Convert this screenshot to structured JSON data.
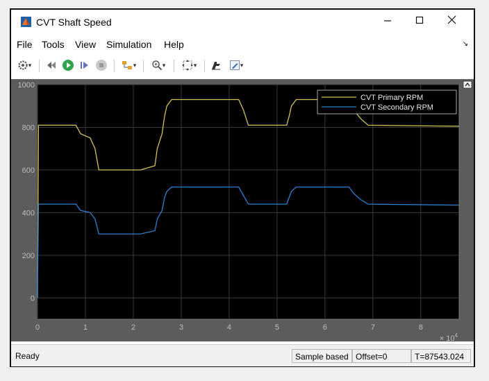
{
  "window": {
    "title": "CVT Shaft Speed"
  },
  "menu": {
    "items": [
      "File",
      "Tools",
      "View",
      "Simulation",
      "Help"
    ]
  },
  "toolbar": {
    "icons": [
      "settings-icon",
      "step-back-icon",
      "run-icon",
      "step-forward-icon",
      "stop-icon",
      "highlight-icon",
      "zoom-icon",
      "autoscale-icon",
      "cursor-measure-icon",
      "style-icon"
    ]
  },
  "status": {
    "ready": "Ready",
    "sample_mode": "Sample based",
    "offset": "Offset=0",
    "time": "T=87543.024"
  },
  "colors": {
    "primary": "#d4c253",
    "secondary": "#2e7fd1",
    "axes_bg": "#000000",
    "figure_bg": "#5c5c5c",
    "grid": "#3a3a3a"
  },
  "chart_data": {
    "type": "line",
    "xlim": [
      0,
      8.8
    ],
    "ylim": [
      -100,
      1000
    ],
    "x_ticks": [
      "0",
      "1",
      "2",
      "3",
      "4",
      "5",
      "6",
      "7",
      "8"
    ],
    "y_ticks": [
      "0",
      "200",
      "400",
      "600",
      "800",
      "1000"
    ],
    "x_exponent": "× 10",
    "x_exponent_power": "4",
    "grid": true,
    "legend_position": "top-right",
    "series": [
      {
        "name": "CVT Primary RPM",
        "x": [
          0,
          0.02,
          0.8,
          0.9,
          1.1,
          1.2,
          1.28,
          2.15,
          2.45,
          2.5,
          2.6,
          2.65,
          2.7,
          2.8,
          4.2,
          4.3,
          4.4,
          5.2,
          5.25,
          5.3,
          5.4,
          6.5,
          6.6,
          6.75,
          6.9,
          8.8
        ],
        "y": [
          0,
          810,
          810,
          770,
          750,
          700,
          600,
          600,
          620,
          700,
          770,
          850,
          900,
          930,
          930,
          880,
          810,
          810,
          850,
          900,
          930,
          930,
          880,
          840,
          810,
          805
        ]
      },
      {
        "name": "CVT Secondary RPM",
        "x": [
          0,
          0.02,
          0.8,
          0.9,
          1.1,
          1.2,
          1.28,
          2.15,
          2.45,
          2.5,
          2.6,
          2.65,
          2.7,
          2.8,
          4.2,
          4.3,
          4.4,
          5.2,
          5.25,
          5.3,
          5.4,
          6.5,
          6.6,
          6.75,
          6.9,
          8.8
        ],
        "y": [
          0,
          440,
          440,
          410,
          400,
          370,
          300,
          300,
          315,
          370,
          410,
          470,
          500,
          520,
          520,
          480,
          440,
          440,
          470,
          500,
          520,
          520,
          490,
          460,
          440,
          435
        ]
      }
    ]
  }
}
